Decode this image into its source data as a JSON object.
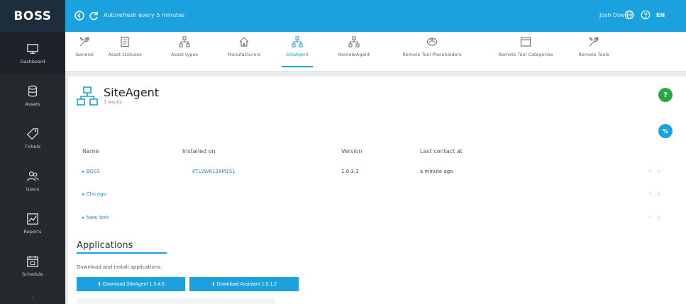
{
  "app": {
    "logo": "BOSS",
    "autorefresh": "Autorefresh every 5 minutes",
    "user": "Josh Doe",
    "lang": "EN"
  },
  "sidebar": {
    "items": [
      {
        "label": "Dashboard",
        "icon": "monitor-icon"
      },
      {
        "label": "Assets",
        "icon": "database-icon"
      },
      {
        "label": "Tickets",
        "icon": "tag-icon"
      },
      {
        "label": "Users",
        "icon": "users-icon"
      },
      {
        "label": "Reports",
        "icon": "chart-icon"
      },
      {
        "label": "Schedule",
        "icon": "calendar-icon"
      }
    ]
  },
  "tabs": [
    {
      "label": "General"
    },
    {
      "label": "Asset statuses"
    },
    {
      "label": "Asset types"
    },
    {
      "label": "Manufacturers"
    },
    {
      "label": "SiteAgent"
    },
    {
      "label": "RemoteAgent"
    },
    {
      "label": "Remote Tool Placeholders"
    },
    {
      "label": "Remote Tool Categories"
    },
    {
      "label": "Remote Tools"
    }
  ],
  "page": {
    "title": "SiteAgent",
    "subtitle": "3 results",
    "help": "?",
    "percent": "%"
  },
  "table": {
    "headers": [
      "Name",
      "Installed on",
      "Version",
      "Last contact at"
    ],
    "rows": [
      {
        "name": "BOSS",
        "installed_on": "KTL2W6128M151",
        "version": "1.0.3.3",
        "last_contact": "a minute ago"
      },
      {
        "name": "Chicago",
        "installed_on": "",
        "version": "",
        "last_contact": ""
      },
      {
        "name": "New York",
        "installed_on": "",
        "version": "",
        "last_contact": ""
      }
    ]
  },
  "applications": {
    "title": "Applications",
    "description": "Download and install applications:",
    "buttons": [
      "⬇ Download SiteAgent 1.3.4.6",
      "⬇ Download Assistant 1.0.1.2"
    ]
  },
  "colors": {
    "accent": "#1ba1dd",
    "sidebar": "#252a2f",
    "help_green": "#28a745",
    "percent_blue": "#1ba1dd"
  }
}
